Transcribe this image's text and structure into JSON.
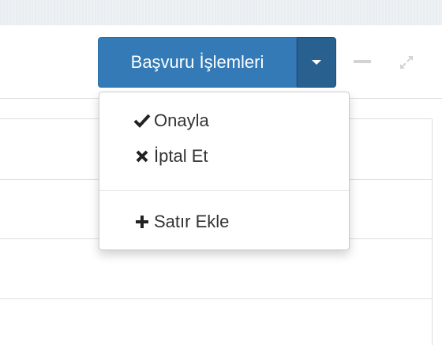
{
  "header": {
    "action_button_label": "Başvuru İşlemleri"
  },
  "dropdown": {
    "items": [
      {
        "label": "Onayla",
        "icon": "checkmark-icon"
      },
      {
        "label": "İptal Et",
        "icon": "times-icon"
      },
      {
        "label": "Satır Ekle",
        "icon": "plus-icon"
      }
    ]
  },
  "colors": {
    "primary": "#337ab7",
    "primary_dark": "#286090",
    "text": "#333333"
  }
}
